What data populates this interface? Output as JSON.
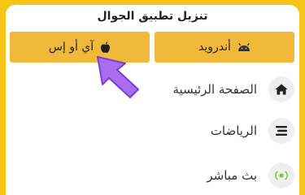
{
  "header": {
    "title": "تنزيل تطبيق الجوال"
  },
  "downloads": {
    "android_label": "أندرويد",
    "ios_label": "آي أو إس"
  },
  "menu": {
    "items": [
      {
        "label": "الصفحة الرئيسية",
        "icon": "home-icon"
      },
      {
        "label": "الرياضات",
        "icon": "menu-bars-icon"
      },
      {
        "label": "بث مباشر",
        "icon": "live-dot-icon"
      }
    ]
  },
  "colors": {
    "frame": "#f5c518",
    "button": "#f0b93a",
    "arrow": "#a86cf0",
    "live_dot": "#7ac143"
  }
}
